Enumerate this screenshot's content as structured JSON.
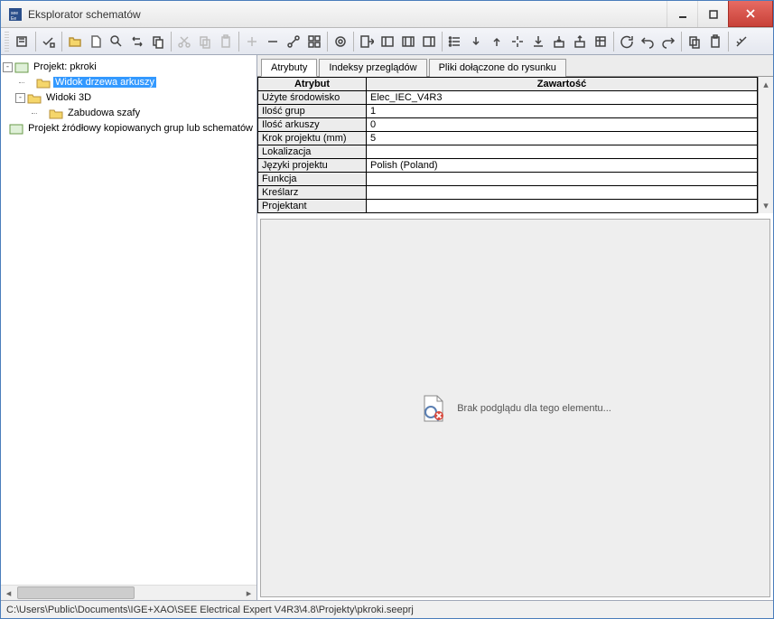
{
  "window": {
    "title": "Eksplorator schematów"
  },
  "tree": {
    "root": "Projekt: pkroki",
    "items": [
      {
        "label": "Widok drzewa arkuszy",
        "selected": true
      },
      {
        "label": "Widoki 3D",
        "expandable": true
      },
      {
        "label": "Zabudowa szafy",
        "indent": 1
      }
    ],
    "extra": "Projekt źródłowy kopiowanych grup lub schematów"
  },
  "tabs": {
    "t1": "Atrybuty",
    "t2": "Indeksy przeglądów",
    "t3": "Pliki dołączone do rysunku"
  },
  "attr_headers": {
    "name": "Atrybut",
    "value": "Zawartość"
  },
  "attributes": [
    {
      "name": "Użyte środowisko",
      "value": "Elec_IEC_V4R3"
    },
    {
      "name": "Ilość grup",
      "value": "1"
    },
    {
      "name": "Ilość arkuszy",
      "value": "0"
    },
    {
      "name": "Krok projektu (mm)",
      "value": "5"
    },
    {
      "name": "Lokalizacja",
      "value": ""
    },
    {
      "name": "Języki projektu",
      "value": "Polish (Poland)"
    },
    {
      "name": "Funkcja",
      "value": ""
    },
    {
      "name": "Kreślarz",
      "value": ""
    },
    {
      "name": "Projektant",
      "value": ""
    }
  ],
  "preview": {
    "message": "Brak podglądu dla tego elementu..."
  },
  "statusbar": {
    "path": "C:\\Users\\Public\\Documents\\IGE+XAO\\SEE Electrical Expert V4R3\\4.8\\Projekty\\pkroki.seeprj"
  }
}
